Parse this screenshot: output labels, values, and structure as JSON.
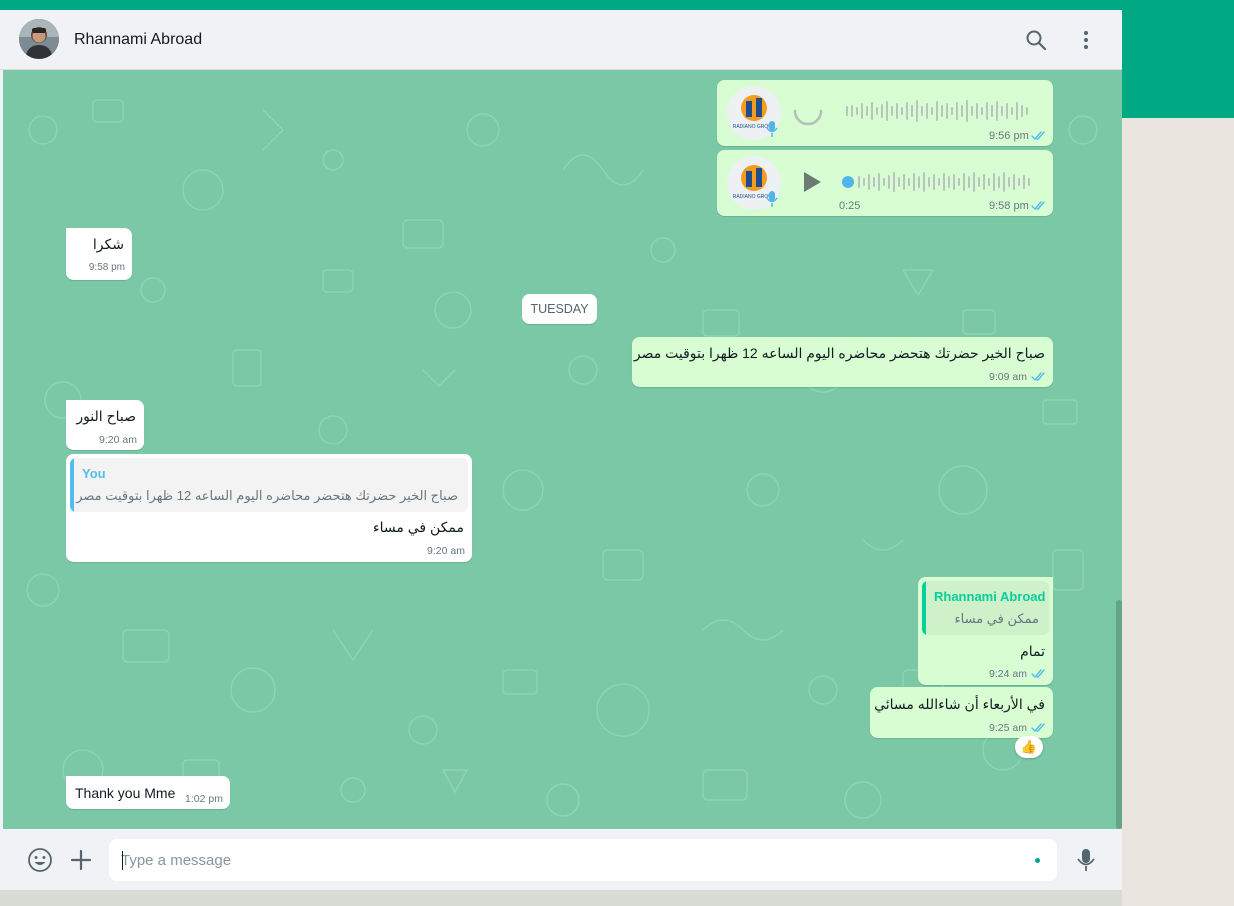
{
  "header": {
    "contact_name": "Rhannami Abroad",
    "search_icon": "search-icon",
    "menu_icon": "kebab-menu-icon"
  },
  "messages": {
    "voice1": {
      "time": "9:56 pm",
      "logo_text": "RADIANO GROUP"
    },
    "voice2": {
      "time": "9:58 pm",
      "duration": "0:25",
      "logo_text": "RADIANO GROUP"
    },
    "m1": {
      "text": "شكرا",
      "time": "9:58 pm"
    },
    "day_separator": "TUESDAY",
    "m2": {
      "text": "صباح الخير حضرتك هتحضر محاضره اليوم الساعه 12 ظهرا بتوقيت مصر",
      "time": "9:09 am"
    },
    "m3": {
      "text": "صباح النور",
      "time": "9:20 am"
    },
    "m4": {
      "quote_author": "You",
      "quote_text": "صباح الخير حضرتك هتحضر محاضره اليوم الساعه 12 ظهرا بتوقيت مصر",
      "text": "ممكن في مساء",
      "time": "9:20 am"
    },
    "m5": {
      "quote_author": "Rhannami Abroad",
      "quote_text": "ممكن في مساء",
      "text": "تمام",
      "time": "9:24 am"
    },
    "m6": {
      "text": "في الأربعاء أن شاءالله مسائي",
      "time": "9:25 am",
      "reaction": "👍"
    },
    "m7": {
      "text": "Thank you Mme",
      "time": "1:02 pm"
    }
  },
  "footer": {
    "placeholder": "Type a message",
    "emoji_icon": "emoji-icon",
    "attach_icon": "plus-icon",
    "mic_icon": "mic-icon"
  },
  "colors": {
    "accent": "#00a884",
    "chat_bg": "#7ac8a5",
    "outgoing": "#d9fdd3",
    "incoming": "#ffffff",
    "tick_blue": "#53bdeb",
    "quote_you": "#53bdeb",
    "quote_contact": "#06cf9c"
  }
}
